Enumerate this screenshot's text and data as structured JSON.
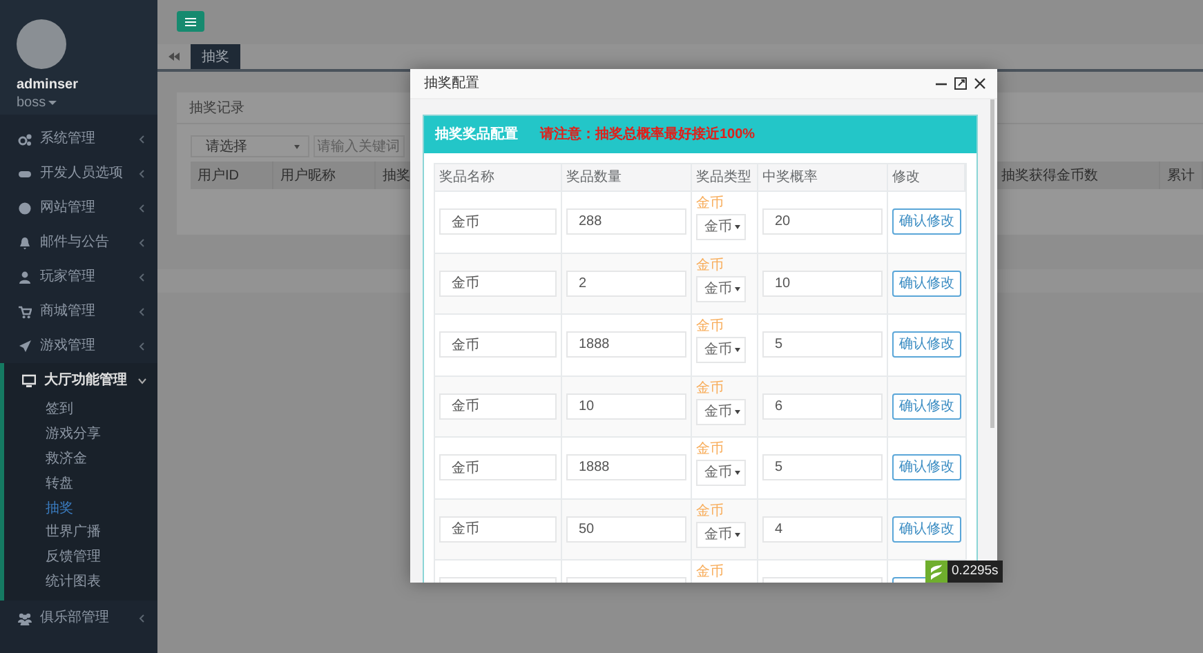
{
  "sidebar": {
    "user": {
      "name": "adminser",
      "role": "boss"
    },
    "items": [
      {
        "label": "系统管理",
        "expanded": false
      },
      {
        "label": "开发人员选项",
        "expanded": false
      },
      {
        "label": "网站管理",
        "expanded": false
      },
      {
        "label": "邮件与公告",
        "expanded": false
      },
      {
        "label": "玩家管理",
        "expanded": false
      },
      {
        "label": "商城管理",
        "expanded": false
      },
      {
        "label": "游戏管理",
        "expanded": false
      },
      {
        "label": "大厅功能管理",
        "expanded": true,
        "children": [
          {
            "label": "签到",
            "selected": false
          },
          {
            "label": "游戏分享",
            "selected": false
          },
          {
            "label": "救济金",
            "selected": false
          },
          {
            "label": "转盘",
            "selected": false
          },
          {
            "label": "抽奖",
            "selected": true
          },
          {
            "label": "世界广播",
            "selected": false
          },
          {
            "label": "反馈管理",
            "selected": false
          },
          {
            "label": "统计图表",
            "selected": false
          }
        ]
      },
      {
        "label": "俱乐部管理",
        "expanded": false
      }
    ]
  },
  "tabs": [
    {
      "label": "抽奖",
      "selected": true
    }
  ],
  "records_panel": {
    "title": "抽奖记录",
    "filter": {
      "value": "请选择"
    },
    "search": {
      "placeholder": "请输入关键词"
    },
    "columns": [
      "用户ID",
      "用户昵称",
      "抽奖",
      "抽奖获得金币数",
      "累计"
    ]
  },
  "modal": {
    "title": "抽奖配置",
    "panel_title": "抽奖奖品配置",
    "warning": "请注意：抽奖总概率最好接近100%",
    "columns": [
      "奖品名称",
      "奖品数量",
      "奖品类型",
      "中奖概率",
      "修改"
    ],
    "rows": [
      {
        "name": "金币",
        "quantity": "288",
        "type_label": "金币",
        "type": "金币",
        "probability": "20",
        "action": "确认修改"
      },
      {
        "name": "金币",
        "quantity": "2",
        "type_label": "金币",
        "type": "金币",
        "probability": "10",
        "action": "确认修改"
      },
      {
        "name": "金币",
        "quantity": "1888",
        "type_label": "金币",
        "type": "金币",
        "probability": "5",
        "action": "确认修改"
      },
      {
        "name": "金币",
        "quantity": "10",
        "type_label": "金币",
        "type": "金币",
        "probability": "6",
        "action": "确认修改"
      },
      {
        "name": "金币",
        "quantity": "1888",
        "type_label": "金币",
        "type": "金币",
        "probability": "5",
        "action": "确认修改"
      },
      {
        "name": "金币",
        "quantity": "50",
        "type_label": "金币",
        "type": "金币",
        "probability": "4",
        "action": "确认修改"
      },
      {
        "type_label": "金币"
      }
    ]
  },
  "timer": {
    "text": "0.2295s"
  }
}
